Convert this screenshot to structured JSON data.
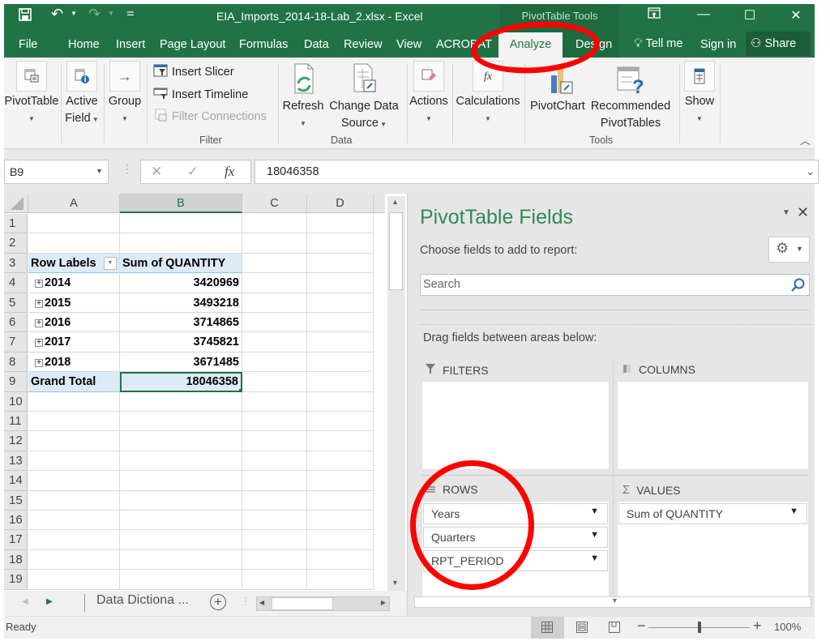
{
  "window": {
    "title": "EIA_Imports_2014-18-Lab_2.xlsx - Excel",
    "context_tools": "PivotTable Tools",
    "quick_access": {
      "save_icon": "save-icon",
      "undo_icon": "undo-icon",
      "redo_icon": "redo-icon",
      "customize_icon": "customize-qat-icon"
    },
    "controls": {
      "ribbon_display": "ribbon-display-icon",
      "minimize": "—",
      "maximize": "☐",
      "close": "✕"
    }
  },
  "menu": {
    "tabs": [
      "File",
      "Home",
      "Insert",
      "Page Layout",
      "Formulas",
      "Data",
      "Review",
      "View",
      "ACROBAT",
      "Analyze",
      "Design"
    ],
    "active_tab": "Analyze",
    "tell_me": "Tell me",
    "sign_in": "Sign in",
    "share": "Share"
  },
  "ribbon": {
    "pivottable": {
      "label": "PivotTable"
    },
    "active_field": {
      "label_line1": "Active",
      "label_line2": "Field"
    },
    "group": {
      "label": "Group"
    },
    "filter": {
      "insert_slicer": "Insert Slicer",
      "insert_timeline": "Insert Timeline",
      "filter_connections": "Filter Connections",
      "group_label": "Filter"
    },
    "data": {
      "refresh": "Refresh",
      "change_source_line1": "Change Data",
      "change_source_line2": "Source",
      "group_label": "Data"
    },
    "actions": {
      "label": "Actions"
    },
    "calculations": {
      "label": "Calculations"
    },
    "tools": {
      "pivotchart": "PivotChart",
      "recommended_line1": "Recommended",
      "recommended_line2": "PivotTables",
      "group_label": "Tools"
    },
    "show": {
      "label": "Show"
    }
  },
  "formula_bar": {
    "name_box": "B9",
    "formula": "18046358",
    "cancel": "✕",
    "enter": "✓",
    "fx": "fx"
  },
  "grid": {
    "columns": [
      "A",
      "B",
      "C",
      "D"
    ],
    "selected_column": "B",
    "rows": [
      "1",
      "2",
      "3",
      "4",
      "5",
      "6",
      "7",
      "8",
      "9",
      "10",
      "11",
      "12",
      "13",
      "14",
      "15",
      "16",
      "17",
      "18",
      "19"
    ],
    "pivot": {
      "row_labels_header": "Row Labels",
      "value_header": "Sum of QUANTITY",
      "rows": [
        {
          "label": "2014",
          "value": "3420969"
        },
        {
          "label": "2015",
          "value": "3493218"
        },
        {
          "label": "2016",
          "value": "3714865"
        },
        {
          "label": "2017",
          "value": "3745821"
        },
        {
          "label": "2018",
          "value": "3671485"
        }
      ],
      "grand_total_label": "Grand Total",
      "grand_total_value": "18046358"
    },
    "active_cell": "B9"
  },
  "sheet_tabs": {
    "tabs": [
      "Data Dictiona ..."
    ],
    "add_sheet": "+"
  },
  "status": {
    "ready": "Ready",
    "zoom": "100%",
    "zoom_minus": "−",
    "zoom_plus": "+",
    "zoom_level": 1.0
  },
  "pivot_pane": {
    "title": "PivotTable Fields",
    "subtitle": "Choose fields to add to report:",
    "search_placeholder": "Search",
    "drag_hint": "Drag fields between areas below:",
    "areas": {
      "filters": {
        "label": "FILTERS",
        "fields": []
      },
      "columns": {
        "label": "COLUMNS",
        "fields": []
      },
      "rows": {
        "label": "ROWS",
        "fields": [
          "Years",
          "Quarters",
          "RPT_PERIOD"
        ]
      },
      "values": {
        "label": "VALUES",
        "fields": [
          "Sum of QUANTITY"
        ]
      }
    }
  },
  "annotations": {
    "highlight_color": "#ff0000",
    "highlighted": [
      "Analyze tab",
      "ROWS area"
    ]
  },
  "colors": {
    "excel_green": "#217346",
    "context_green": "#1e6a3f",
    "pivot_header_blue": "#ddebf7",
    "pane_title_green": "#2e8b57"
  }
}
